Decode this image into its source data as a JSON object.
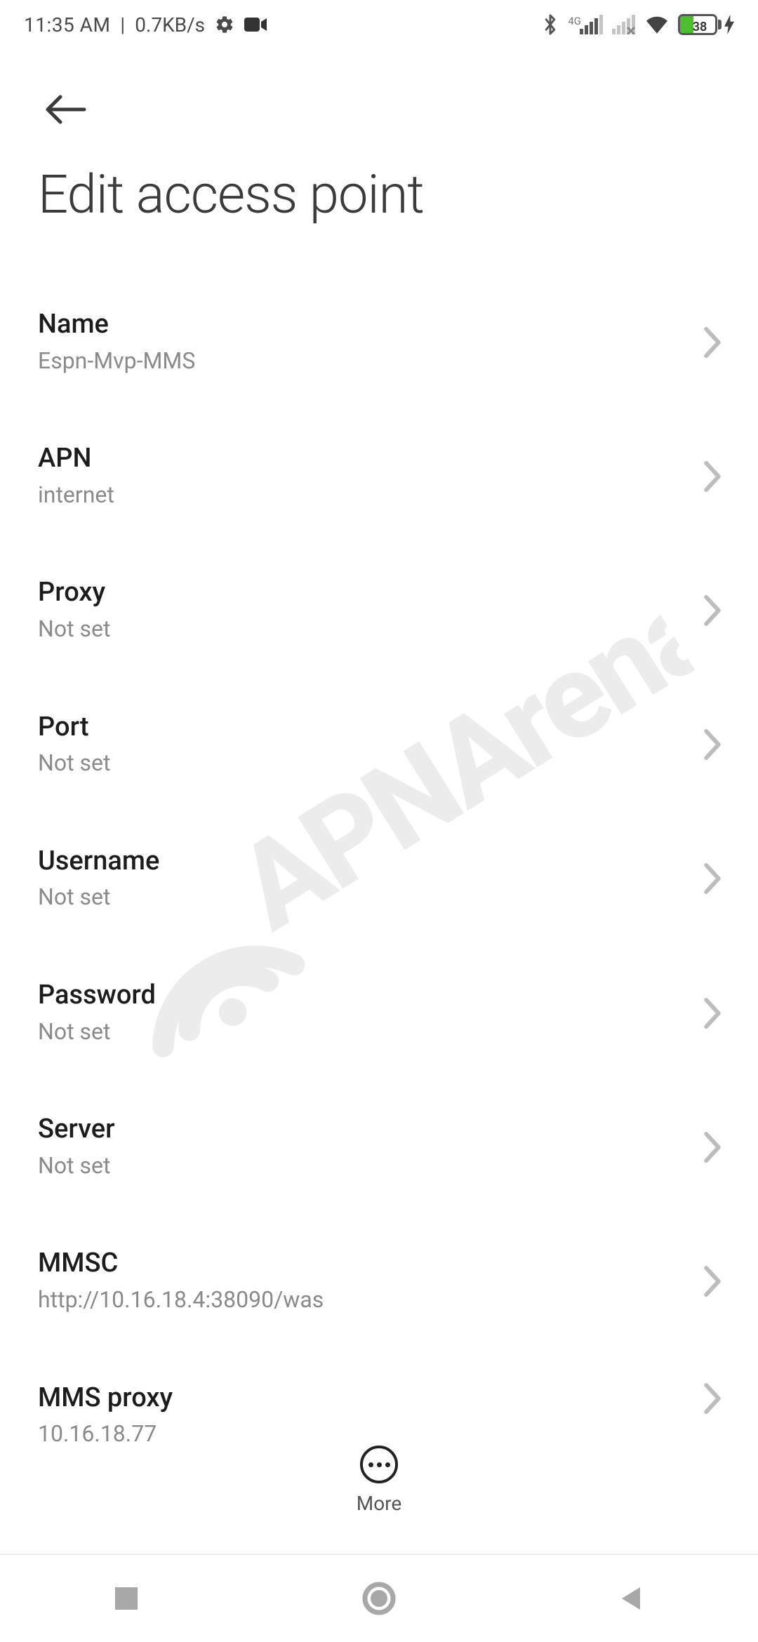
{
  "status_bar": {
    "time": "11:35 AM",
    "divider": "|",
    "speed": "0.7KB/s",
    "network_label": "4G",
    "battery_percent_text": "38",
    "battery_percent": 38
  },
  "header": {
    "title": "Edit access point"
  },
  "settings": [
    {
      "key": "name",
      "label": "Name",
      "value": "Espn-Mvp-MMS"
    },
    {
      "key": "apn",
      "label": "APN",
      "value": "internet"
    },
    {
      "key": "proxy",
      "label": "Proxy",
      "value": "Not set"
    },
    {
      "key": "port",
      "label": "Port",
      "value": "Not set"
    },
    {
      "key": "username",
      "label": "Username",
      "value": "Not set"
    },
    {
      "key": "password",
      "label": "Password",
      "value": "Not set"
    },
    {
      "key": "server",
      "label": "Server",
      "value": "Not set"
    },
    {
      "key": "mmsc",
      "label": "MMSC",
      "value": "http://10.16.18.4:38090/was"
    },
    {
      "key": "mms_proxy",
      "label": "MMS proxy",
      "value": "10.16.18.77"
    }
  ],
  "more_button": {
    "label": "More"
  },
  "watermark_text": "APNArena"
}
